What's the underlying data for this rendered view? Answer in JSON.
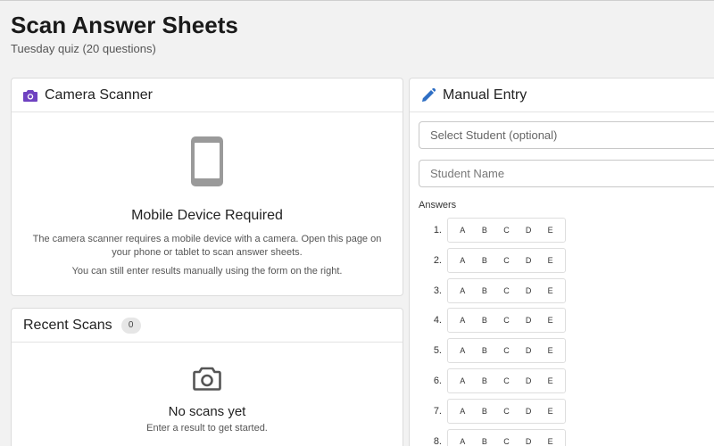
{
  "page": {
    "title": "Scan Answer Sheets",
    "subtitle": "Tuesday quiz (20 questions)"
  },
  "camera_card": {
    "title": "Camera Scanner",
    "heading": "Mobile Device Required",
    "text": "The camera scanner requires a mobile device with a camera. Open this page on your phone or tablet to scan answer sheets.",
    "text2": "You can still enter results manually using the form on the right."
  },
  "recent_card": {
    "title": "Recent Scans",
    "count": "0",
    "empty_heading": "No scans yet",
    "empty_text": "Enter a result to get started."
  },
  "manual_card": {
    "title": "Manual Entry",
    "student_select": "Select Student (optional)",
    "name_placeholder": "Student Name",
    "answers_label": "Answers",
    "choices": [
      "A",
      "B",
      "C",
      "D",
      "E"
    ],
    "rows": [
      "1.",
      "2.",
      "3.",
      "4.",
      "5.",
      "6.",
      "7.",
      "8."
    ]
  },
  "colors": {
    "camera_icon": "#6f42c1",
    "pencil_icon": "#2f6fc4",
    "phone_icon": "#9a9a9a"
  }
}
